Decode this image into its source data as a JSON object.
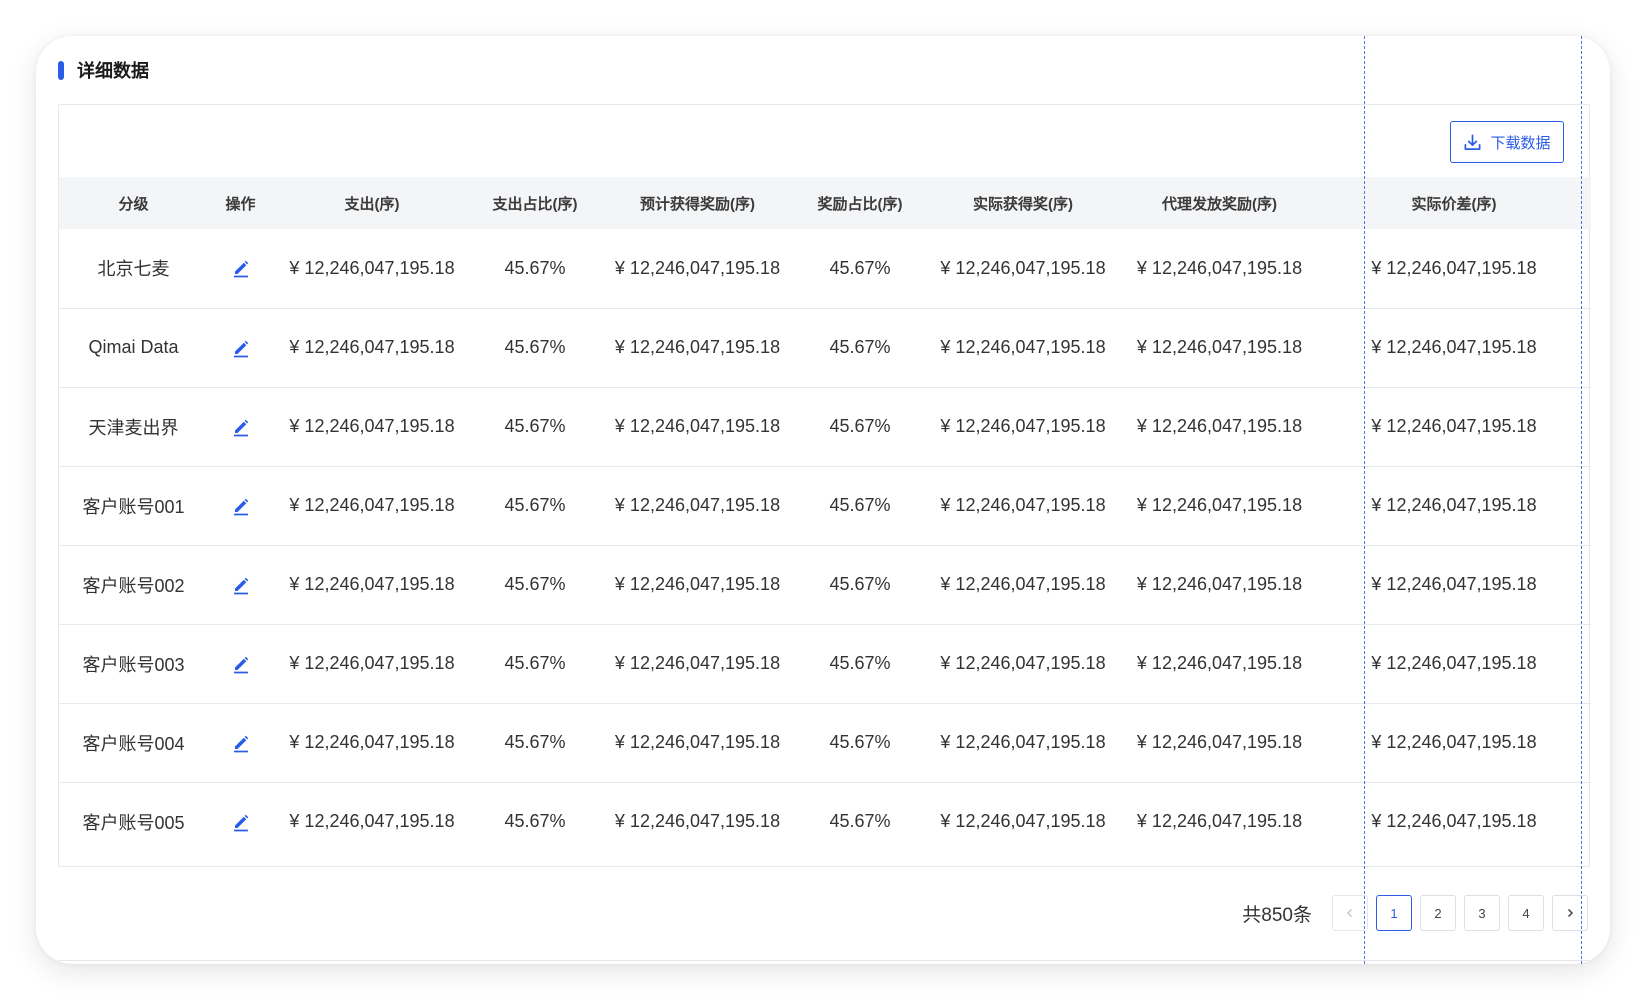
{
  "section_title": "详细数据",
  "download_label": "下载数据",
  "columns": [
    "分级",
    "操作",
    "支出(序)",
    "支出占比(序)",
    "预计获得奖励(序)",
    "奖励占比(序)",
    "实际获得奖(序)",
    "代理发放奖励(序)",
    "实际价差(序)"
  ],
  "rows": [
    [
      "北京七麦",
      "¥ 12,246,047,195.18",
      "45.67%",
      "¥ 12,246,047,195.18",
      "45.67%",
      "¥ 12,246,047,195.18",
      "¥ 12,246,047,195.18",
      "¥ 12,246,047,195.18"
    ],
    [
      "Qimai Data",
      "¥ 12,246,047,195.18",
      "45.67%",
      "¥ 12,246,047,195.18",
      "45.67%",
      "¥ 12,246,047,195.18",
      "¥ 12,246,047,195.18",
      "¥ 12,246,047,195.18"
    ],
    [
      "天津麦出界",
      "¥ 12,246,047,195.18",
      "45.67%",
      "¥ 12,246,047,195.18",
      "45.67%",
      "¥ 12,246,047,195.18",
      "¥ 12,246,047,195.18",
      "¥ 12,246,047,195.18"
    ],
    [
      "客户账号001",
      "¥ 12,246,047,195.18",
      "45.67%",
      "¥ 12,246,047,195.18",
      "45.67%",
      "¥ 12,246,047,195.18",
      "¥ 12,246,047,195.18",
      "¥ 12,246,047,195.18"
    ],
    [
      "客户账号002",
      "¥ 12,246,047,195.18",
      "45.67%",
      "¥ 12,246,047,195.18",
      "45.67%",
      "¥ 12,246,047,195.18",
      "¥ 12,246,047,195.18",
      "¥ 12,246,047,195.18"
    ],
    [
      "客户账号003",
      "¥ 12,246,047,195.18",
      "45.67%",
      "¥ 12,246,047,195.18",
      "45.67%",
      "¥ 12,246,047,195.18",
      "¥ 12,246,047,195.18",
      "¥ 12,246,047,195.18"
    ],
    [
      "客户账号004",
      "¥ 12,246,047,195.18",
      "45.67%",
      "¥ 12,246,047,195.18",
      "45.67%",
      "¥ 12,246,047,195.18",
      "¥ 12,246,047,195.18",
      "¥ 12,246,047,195.18"
    ],
    [
      "客户账号005",
      "¥ 12,246,047,195.18",
      "45.67%",
      "¥ 12,246,047,195.18",
      "45.67%",
      "¥ 12,246,047,195.18",
      "¥ 12,246,047,195.18",
      "¥ 12,246,047,195.18"
    ]
  ],
  "pagination": {
    "total_label": "共850条",
    "pages": [
      "1",
      "2",
      "3",
      "4"
    ],
    "current_page": "1"
  },
  "icons": {
    "edit": "edit-icon",
    "download": "download-icon",
    "prev": "chevron-left-icon",
    "next": "chevron-right-icon"
  },
  "colors": {
    "accent": "#2a5ce8",
    "header_bg": "#f4f5f7",
    "border": "#e8e9ed"
  }
}
